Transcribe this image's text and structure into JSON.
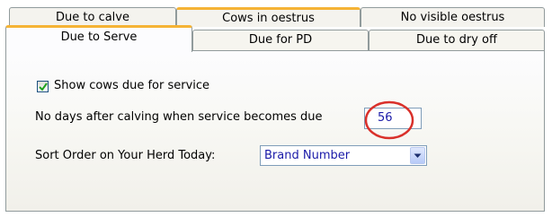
{
  "tabs": {
    "row1": [
      {
        "label": "Due to calve"
      },
      {
        "label": "Cows in oestrus"
      },
      {
        "label": "No visible oestrus"
      }
    ],
    "row2": [
      {
        "label": "Due to Serve"
      },
      {
        "label": "Due for PD"
      },
      {
        "label": "Due to dry off"
      }
    ],
    "selected": "Due to Serve",
    "hot": "Cows in oestrus"
  },
  "panel": {
    "show_cows_checkbox": {
      "label": "Show cows due for service",
      "checked": true
    },
    "days_after_calving": {
      "label": "No days after calving when service becomes due",
      "value": "56"
    },
    "sort_order": {
      "label": "Sort Order on Your Herd Today:",
      "selected": "Brand Number"
    }
  },
  "colors": {
    "tab_hot_accent": "#f5b335",
    "annotation_circle": "#d9302a",
    "input_text": "#1a1aa8"
  },
  "icons": [
    "checkmark-icon",
    "dropdown-arrow-icon"
  ]
}
